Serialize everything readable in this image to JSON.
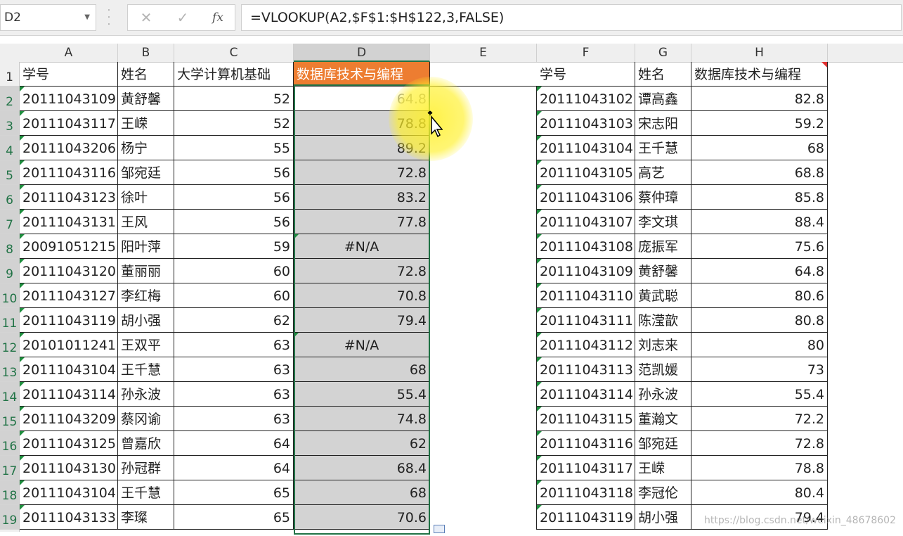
{
  "formula_bar": {
    "name_box": "D2",
    "cancel_icon": "✕",
    "enter_icon": "✓",
    "fx_label": "fx",
    "formula": "=VLOOKUP(A2,$F$1:$H$122,3,FALSE)"
  },
  "columns": [
    "A",
    "B",
    "C",
    "D",
    "E",
    "F",
    "G",
    "H"
  ],
  "rows": [
    "1",
    "2",
    "3",
    "4",
    "5",
    "6",
    "7",
    "8",
    "9",
    "10",
    "11",
    "12",
    "13",
    "14",
    "15",
    "16",
    "17",
    "18",
    "19"
  ],
  "left_table": {
    "headers": [
      "学号",
      "姓名",
      "大学计算机基础",
      "数据库技术与编程"
    ],
    "rows": [
      [
        "20111043109",
        "黄舒馨",
        "52",
        "64.8"
      ],
      [
        "20111043117",
        "王嵘",
        "52",
        "78.8"
      ],
      [
        "20111043206",
        "杨宁",
        "55",
        "89.2"
      ],
      [
        "20111043116",
        "邹宛廷",
        "56",
        "72.8"
      ],
      [
        "20111043123",
        "徐叶",
        "56",
        "83.2"
      ],
      [
        "20111043131",
        "王风",
        "56",
        "77.8"
      ],
      [
        "20091051215",
        "阳叶萍",
        "59",
        "#N/A"
      ],
      [
        "20111043120",
        "董丽丽",
        "60",
        "72.8"
      ],
      [
        "20111043127",
        "李红梅",
        "60",
        "70.8"
      ],
      [
        "20111043119",
        "胡小强",
        "62",
        "79.4"
      ],
      [
        "20101011241",
        "王双平",
        "63",
        "#N/A"
      ],
      [
        "20111043104",
        "王千慧",
        "63",
        "68"
      ],
      [
        "20111043114",
        "孙永波",
        "63",
        "55.4"
      ],
      [
        "20111043209",
        "蔡冈谕",
        "63",
        "74.8"
      ],
      [
        "20111043125",
        "曾嘉欣",
        "64",
        "62"
      ],
      [
        "20111043130",
        "孙冠群",
        "64",
        "68.4"
      ],
      [
        "20111043104",
        "王千慧",
        "65",
        "68"
      ],
      [
        "20111043133",
        "李璨",
        "65",
        "70.6"
      ]
    ]
  },
  "right_table": {
    "headers": [
      "学号",
      "姓名",
      "数据库技术与编程"
    ],
    "rows": [
      [
        "20111043102",
        "谭高鑫",
        "82.8"
      ],
      [
        "20111043103",
        "宋志阳",
        "59.2"
      ],
      [
        "20111043104",
        "王千慧",
        "68"
      ],
      [
        "20111043105",
        "高艺",
        "68.8"
      ],
      [
        "20111043106",
        "蔡仲璋",
        "85.8"
      ],
      [
        "20111043107",
        "李文琪",
        "88.4"
      ],
      [
        "20111043108",
        "庞振军",
        "75.6"
      ],
      [
        "20111043109",
        "黄舒馨",
        "64.8"
      ],
      [
        "20111043110",
        "黄武聪",
        "80.6"
      ],
      [
        "20111043111",
        "陈滢歆",
        "80.8"
      ],
      [
        "20111043112",
        "刘志来",
        "80"
      ],
      [
        "20111043113",
        "范凯媛",
        "73"
      ],
      [
        "20111043114",
        "孙永波",
        "55.4"
      ],
      [
        "20111043115",
        "董瀚文",
        "72.2"
      ],
      [
        "20111043116",
        "邹宛廷",
        "72.8"
      ],
      [
        "20111043117",
        "王嵘",
        "78.8"
      ],
      [
        "20111043118",
        "李冠伦",
        "80.4"
      ],
      [
        "20111043119",
        "胡小强",
        "79.4"
      ]
    ]
  },
  "watermark": "https://blog.csdn.net/weixin_48678602",
  "colors": {
    "header_fill": "#ed7d31",
    "selection": "#217346",
    "selected_fill": "#d3d3d3"
  }
}
